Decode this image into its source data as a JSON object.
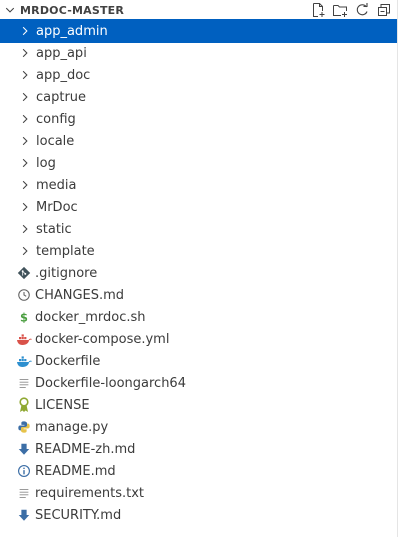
{
  "explorer": {
    "title": "MRDOC-MASTER",
    "actions": [
      {
        "name": "new-file-icon",
        "tooltip": "New File..."
      },
      {
        "name": "new-folder-icon",
        "tooltip": "New Folder..."
      },
      {
        "name": "refresh-icon",
        "tooltip": "Refresh Explorer"
      },
      {
        "name": "collapse-all-icon",
        "tooltip": "Collapse Folders in Explorer"
      }
    ],
    "folders": [
      {
        "label": "app_admin",
        "selected": true
      },
      {
        "label": "app_api"
      },
      {
        "label": "app_doc"
      },
      {
        "label": "captrue"
      },
      {
        "label": "config"
      },
      {
        "label": "locale"
      },
      {
        "label": "log"
      },
      {
        "label": "media"
      },
      {
        "label": "MrDoc"
      },
      {
        "label": "static"
      },
      {
        "label": "template"
      }
    ],
    "files": [
      {
        "label": ".gitignore",
        "icon": "git-icon"
      },
      {
        "label": "CHANGES.md",
        "icon": "clock-icon"
      },
      {
        "label": "docker_mrdoc.sh",
        "icon": "shell-icon"
      },
      {
        "label": "docker-compose.yml",
        "icon": "docker-compose-icon"
      },
      {
        "label": "Dockerfile",
        "icon": "docker-icon"
      },
      {
        "label": "Dockerfile-loongarch64",
        "icon": "text-lines-icon"
      },
      {
        "label": "LICENSE",
        "icon": "license-icon"
      },
      {
        "label": "manage.py",
        "icon": "python-icon"
      },
      {
        "label": "README-zh.md",
        "icon": "markdown-download-icon"
      },
      {
        "label": "README.md",
        "icon": "info-icon"
      },
      {
        "label": "requirements.txt",
        "icon": "text-lines-icon"
      },
      {
        "label": "SECURITY.md",
        "icon": "markdown-download-icon"
      }
    ]
  },
  "colors": {
    "selection": "#0060c0",
    "text": "#3b3b3b",
    "icon_gray": "#616161",
    "shell_green": "#4a9e3f",
    "docker_blue": "#2d8fcf",
    "license_green": "#8fa832",
    "markdown_blue": "#3c6ea6",
    "git_dark": "#41535b",
    "compose_red": "#d9524a"
  }
}
